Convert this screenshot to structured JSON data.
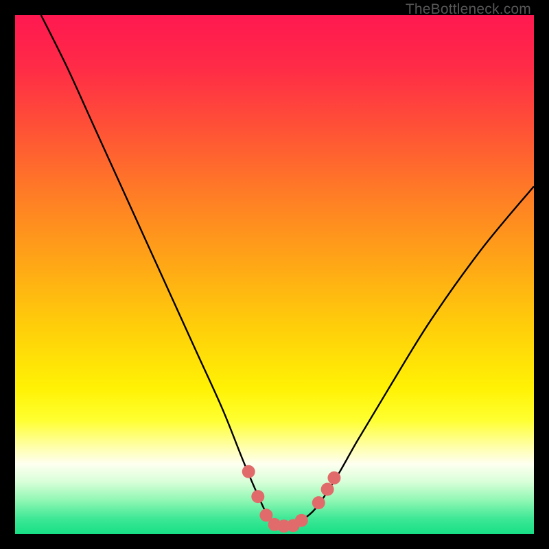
{
  "watermark": "TheBottleneck.com",
  "chart_data": {
    "type": "line",
    "title": "",
    "xlabel": "",
    "ylabel": "",
    "xlim": [
      0,
      100
    ],
    "ylim": [
      0,
      100
    ],
    "background_gradient": {
      "stops": [
        {
          "offset": 0.0,
          "color": "#ff1850"
        },
        {
          "offset": 0.1,
          "color": "#ff2b47"
        },
        {
          "offset": 0.22,
          "color": "#ff5236"
        },
        {
          "offset": 0.35,
          "color": "#ff7e25"
        },
        {
          "offset": 0.48,
          "color": "#ffa716"
        },
        {
          "offset": 0.6,
          "color": "#ffce0a"
        },
        {
          "offset": 0.72,
          "color": "#fff204"
        },
        {
          "offset": 0.78,
          "color": "#ffff30"
        },
        {
          "offset": 0.835,
          "color": "#ffffb0"
        },
        {
          "offset": 0.865,
          "color": "#fefff0"
        },
        {
          "offset": 0.9,
          "color": "#d8ffd8"
        },
        {
          "offset": 0.935,
          "color": "#90f7b4"
        },
        {
          "offset": 0.97,
          "color": "#3fe896"
        },
        {
          "offset": 1.0,
          "color": "#17df85"
        }
      ]
    },
    "series": [
      {
        "name": "bottleneck-curve",
        "color": "#000000",
        "x": [
          5,
          10,
          15,
          20,
          25,
          30,
          35,
          40,
          44,
          47,
          49,
          51,
          53,
          55,
          58,
          62,
          66,
          72,
          80,
          90,
          100
        ],
        "y": [
          100,
          90,
          79,
          68,
          57,
          46,
          35,
          24,
          14,
          7,
          3,
          1.5,
          1.5,
          2.5,
          5,
          11,
          18,
          28,
          41,
          55,
          67
        ]
      }
    ],
    "markers": {
      "name": "highlight-dots",
      "color": "#e16b6b",
      "points": [
        {
          "x": 45.0,
          "y": 12.0
        },
        {
          "x": 46.8,
          "y": 7.2
        },
        {
          "x": 48.4,
          "y": 3.6
        },
        {
          "x": 50.0,
          "y": 1.8
        },
        {
          "x": 51.8,
          "y": 1.5
        },
        {
          "x": 53.6,
          "y": 1.6
        },
        {
          "x": 55.2,
          "y": 2.6
        },
        {
          "x": 58.5,
          "y": 6.0
        },
        {
          "x": 60.2,
          "y": 8.6
        },
        {
          "x": 61.5,
          "y": 10.8
        }
      ]
    }
  }
}
